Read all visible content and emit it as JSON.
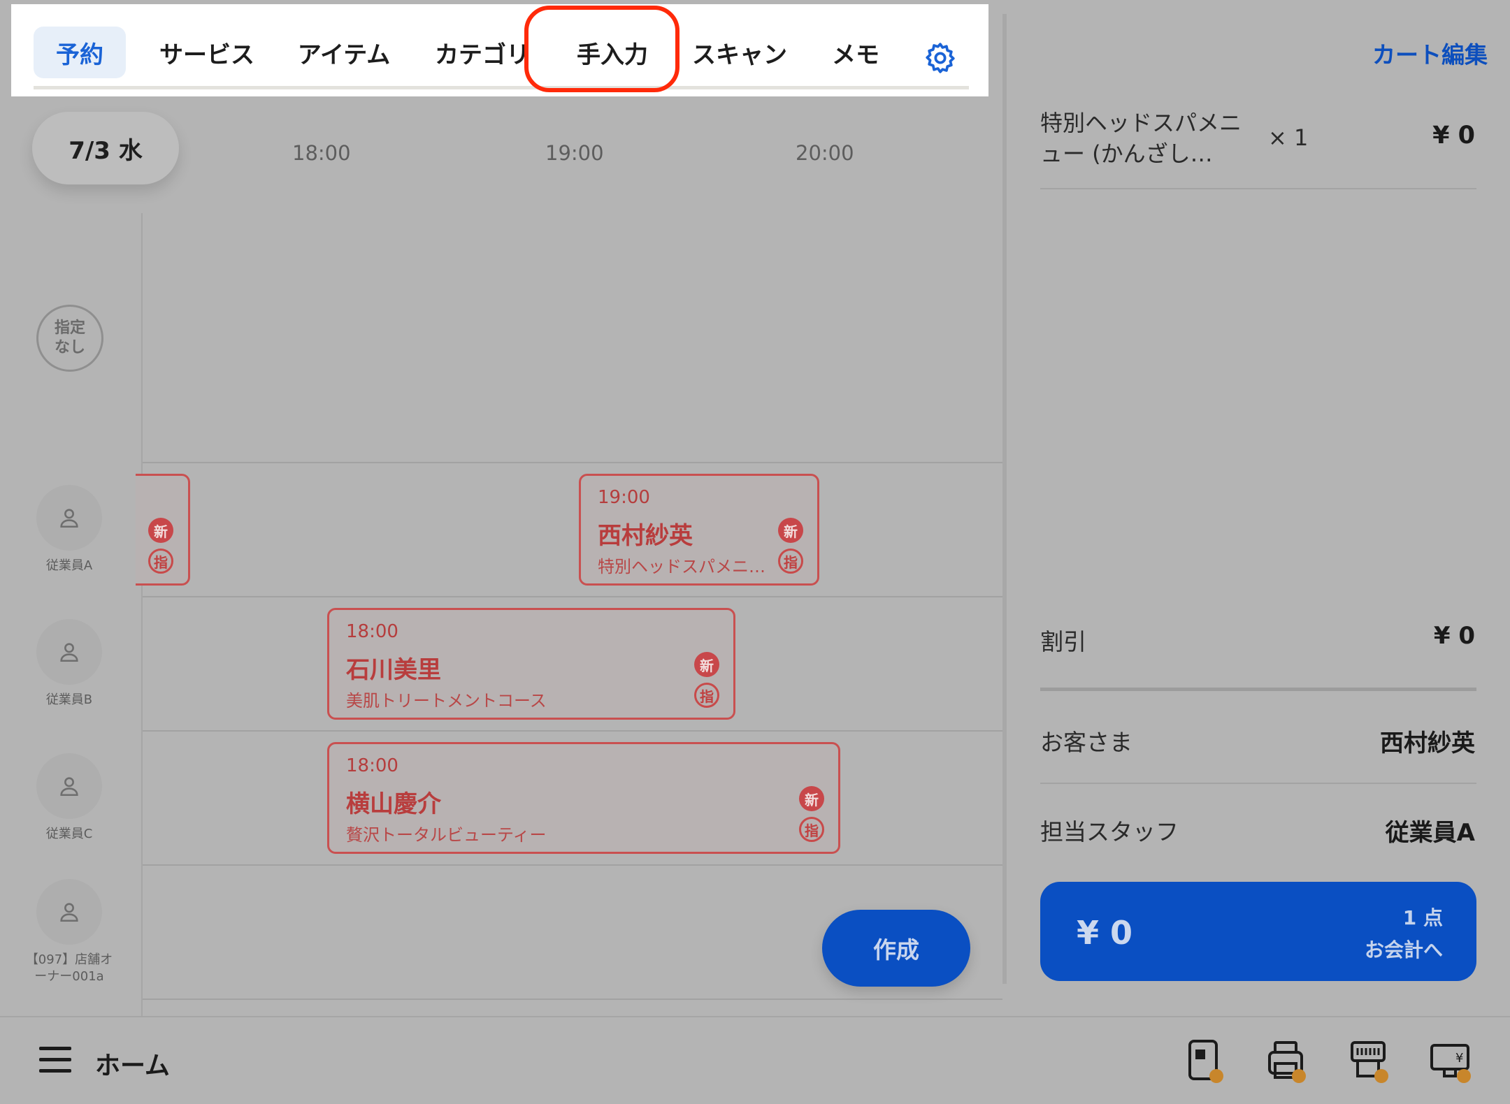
{
  "tabs": [
    {
      "label": "予約",
      "active": true
    },
    {
      "label": "サービス",
      "active": false
    },
    {
      "label": "アイテム",
      "active": false
    },
    {
      "label": "カテゴリ",
      "active": false
    },
    {
      "label": "手入力",
      "active": false,
      "highlighted": true
    },
    {
      "label": "スキャン",
      "active": false
    },
    {
      "label": "メモ",
      "active": false
    }
  ],
  "schedule": {
    "date": "7/3 水",
    "times": [
      "18:00",
      "19:00",
      "20:00"
    ],
    "unassigned_label": [
      "指定",
      "なし"
    ],
    "staff": [
      "従業員A",
      "従業員B",
      "従業員C",
      "【097】店舗オ",
      "ーナー001a"
    ],
    "badge_new": "新",
    "badge_shi": "指",
    "appointments": [
      {
        "time": "19:00",
        "name": "西村紗英",
        "menu": "特別ヘッドスパメニ…"
      },
      {
        "time": "18:00",
        "name": "石川美里",
        "menu": "美肌トリートメントコース"
      },
      {
        "time": "18:00",
        "name": "横山慶介",
        "menu": "贅沢トータルビューティー"
      }
    ],
    "create_label": "作成"
  },
  "cart": {
    "edit_label": "カート編集",
    "item": {
      "name": "特別ヘッドスパメニュー (かんざし…",
      "qty": "× 1",
      "price": "¥ 0"
    },
    "discount_label": "割引",
    "discount_value": "¥ 0",
    "customer_label": "お客さま",
    "customer_value": "西村紗英",
    "staff_label": "担当スタッフ",
    "staff_value": "従業員A",
    "checkout_total": "¥ 0",
    "checkout_count": "1 点",
    "checkout_label": "お会計へ"
  },
  "bottom": {
    "home_label": "ホーム",
    "icons": [
      "card-reader-icon",
      "receipt-printer-icon",
      "barcode-printer-icon",
      "customer-display-icon"
    ]
  },
  "colors": {
    "accent": "#0a4fc2",
    "highlight": "#ff2a0a",
    "appointment": "#c95050"
  }
}
